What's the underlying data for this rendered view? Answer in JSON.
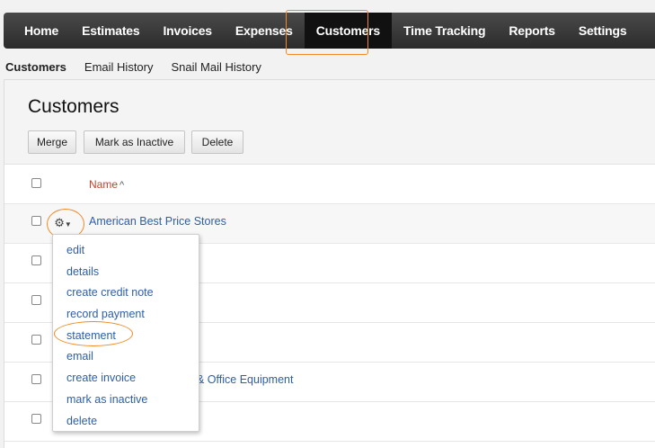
{
  "topnav": {
    "items": [
      {
        "label": "Home"
      },
      {
        "label": "Estimates"
      },
      {
        "label": "Invoices"
      },
      {
        "label": "Expenses"
      },
      {
        "label": "Customers",
        "active": true
      },
      {
        "label": "Time Tracking"
      },
      {
        "label": "Reports"
      },
      {
        "label": "Settings"
      }
    ]
  },
  "subnav": {
    "items": [
      {
        "label": "Customers",
        "active": true
      },
      {
        "label": "Email History"
      },
      {
        "label": "Snail Mail History"
      }
    ]
  },
  "page": {
    "title": "Customers",
    "buttons": {
      "merge": "Merge",
      "mark_inactive": "Mark as Inactive",
      "delete": "Delete"
    }
  },
  "table": {
    "name_header": "Name",
    "sort_indicator": "^",
    "rows": [
      {
        "name": "American Best Price Stores"
      },
      {
        "name": ""
      },
      {
        "name": ""
      },
      {
        "name": ""
      },
      {
        "name": "& Office Equipment"
      },
      {
        "name": ""
      }
    ]
  },
  "actions_menu": {
    "gear_icon": "gear-icon",
    "items": [
      {
        "label": "edit"
      },
      {
        "label": "details"
      },
      {
        "label": "create credit note"
      },
      {
        "label": "record payment"
      },
      {
        "label": "statement"
      },
      {
        "label": "email"
      },
      {
        "label": "create invoice"
      },
      {
        "label": "mark as inactive"
      },
      {
        "label": "delete"
      }
    ]
  },
  "colors": {
    "accent": "#f08a24",
    "link": "#2c5fa8",
    "sort_header": "#c8402a",
    "nav_bg": "#333333"
  }
}
